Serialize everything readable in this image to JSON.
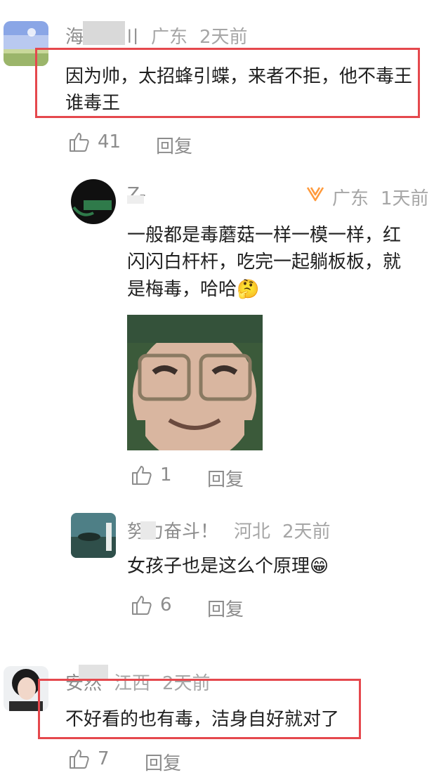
{
  "comments": [
    {
      "username": "海纳百川",
      "location": "广东",
      "time": "2天前",
      "text": "因为帅，太招蜂引蝶，来者不拒，他不毒王 谁毒王",
      "likes": "41",
      "reply_label": "回复"
    },
    {
      "username": "Z-",
      "location": "广东",
      "time": "1天前",
      "text_lines": [
        "一般都是毒蘑菇一样一模一样，红",
        "闪闪白杆杆，吃完一起躺板板，就",
        "是梅毒，哈哈"
      ],
      "emoji": "🤔",
      "likes": "1",
      "reply_label": "回复"
    },
    {
      "username": "努力奋斗！",
      "location": "河北",
      "time": "2天前",
      "text": "女孩子也是这么个原理",
      "emoji": "😁",
      "likes": "6",
      "reply_label": "回复"
    },
    {
      "username": "安然",
      "location": "江西",
      "time": "2天前",
      "text": "不好看的也有毒，洁身自好就对了",
      "likes": "7",
      "reply_label": "回复"
    }
  ],
  "colors": {
    "highlight": "#e5484d",
    "text": "#1f1f1f",
    "meta": "#a6a6a6",
    "badge": "#ff9a3c"
  },
  "icons": {
    "like": "thumbs-up-icon",
    "badge": "v-badge-icon"
  }
}
